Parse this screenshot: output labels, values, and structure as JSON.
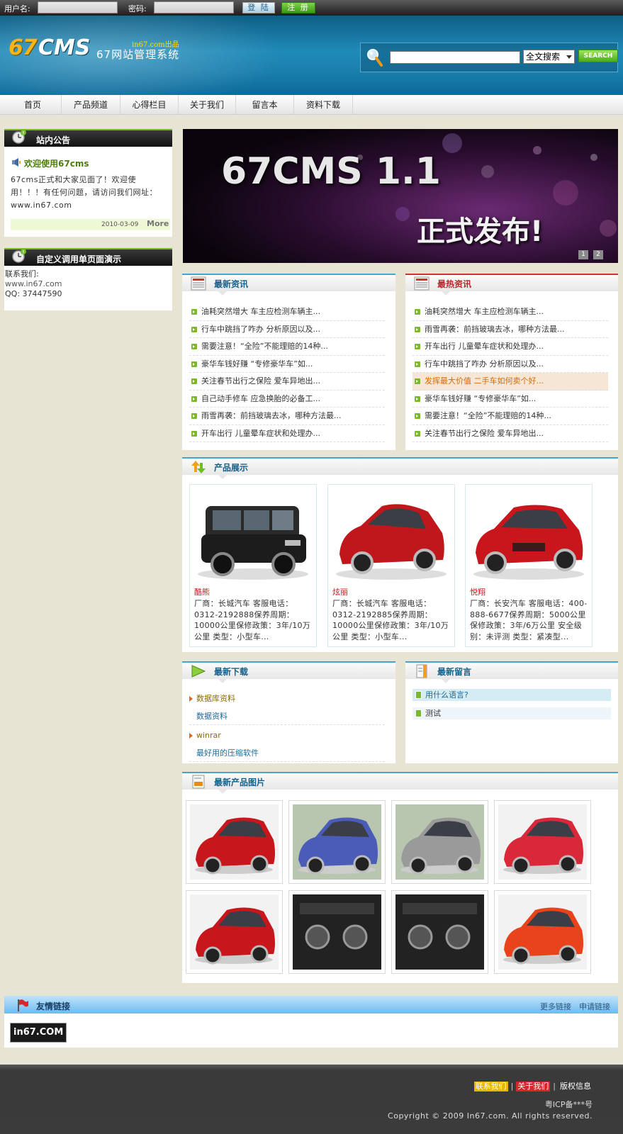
{
  "login": {
    "username_label": "用户名:",
    "password_label": "密码:",
    "login_btn": "登 陆",
    "register_btn": "注 册"
  },
  "brand": {
    "logo_num": "67",
    "logo_text": "CMS",
    "subtitle": "67网站管理系统",
    "tagline": "in67.com出品"
  },
  "search": {
    "select_value": "全文搜索",
    "button": "SEARCH"
  },
  "nav": [
    "首页",
    "产品频道",
    "心得栏目",
    "关于我们",
    "留言本",
    "资料下载"
  ],
  "announce": {
    "title": "站内公告",
    "item_title": "欢迎使用67cms",
    "text": "67cms正式和大家见面了！欢迎使用！！！有任何问题，请访问我们网址：www.in67.com",
    "date": "2010-03-09",
    "more": "More"
  },
  "custom": {
    "title": "自定义调用单页面演示",
    "line1": "联系我们:",
    "line2": "www.in67.com",
    "line3": "QQ: 37447590"
  },
  "banner": {
    "title": "67CMS 1.1",
    "subtitle": "正式发布!",
    "pages": [
      "1",
      "2"
    ]
  },
  "latest_news": {
    "title": "最新资讯",
    "items": [
      "油耗突然增大 车主应检测车辆主...",
      "行车中跳挡了咋办 分析原因以及...",
      "需要注意！“全险”不能理赔的14种...",
      "豪华车钱好赚 “专修豪华车”如...",
      "关注春节出行之保险  爱车异地出...",
      "自己动手修车 应急换胎的必备工...",
      "雨雪再袭：前挡玻璃去冰，哪种方法最...",
      "开车出行 儿童晕车症状和处理办..."
    ]
  },
  "hot_news": {
    "title": "最热资讯",
    "items": [
      "油耗突然增大 车主应检测车辆主...",
      "雨雪再袭：前挡玻璃去冰，哪种方法最...",
      "开车出行 儿童晕车症状和处理办...",
      "行车中跳挡了咋办 分析原因以及...",
      "发挥最大价值 二手车如何卖个好...",
      "豪华车钱好赚 “专修豪华车”如...",
      "需要注意！“全险”不能理赔的14种...",
      "关注春节出行之保险  爱车异地出..."
    ]
  },
  "products": {
    "title": "产品展示",
    "items": [
      {
        "name": "酷熊",
        "desc": "厂商：长城汽车 客服电话：0312-2192888保养周期：10000公里保修政策：3年/10万公里 类型：小型车...",
        "color": "#222222"
      },
      {
        "name": "炫丽",
        "desc": "厂商：长城汽车 客服电话：0312-2192885保养周期：10000公里保修政策：3年/10万公里 类型：小型车...",
        "color": "#c0171d"
      },
      {
        "name": "悦翔",
        "desc": "厂商：长安汽车 客服电话：400-888-6677保养周期：5000公里保修政策：3年/6万公里 安全级别：未评测 类型：紧凑型...",
        "color": "#c8161c"
      }
    ]
  },
  "downloads": {
    "title": "最新下载",
    "items": [
      {
        "cat": "数据库资料",
        "sub": "数据资料"
      },
      {
        "cat": "winrar",
        "sub": "最好用的压缩软件"
      }
    ]
  },
  "messages": {
    "title": "最新留言",
    "items": [
      "用什么语言?",
      "测试"
    ]
  },
  "gallery": {
    "title": "最新产品图片",
    "colors": [
      "#c7161c",
      "#4a5bb8",
      "#9a9a9a",
      "#d8283a",
      "#c7161c",
      "#2b2b2b",
      "#1a1a1a",
      "#e8431a"
    ]
  },
  "links": {
    "title": "友情链接",
    "more": "更多链接",
    "apply": "申请链接",
    "logo": "in67.COM"
  },
  "footer": {
    "contact": "联系我们",
    "about": "关于我们",
    "copyright_info": "版权信息",
    "icp": "粤ICP备***号",
    "copyright": "Copyright © 2009 In67.com. All rights reserved."
  }
}
